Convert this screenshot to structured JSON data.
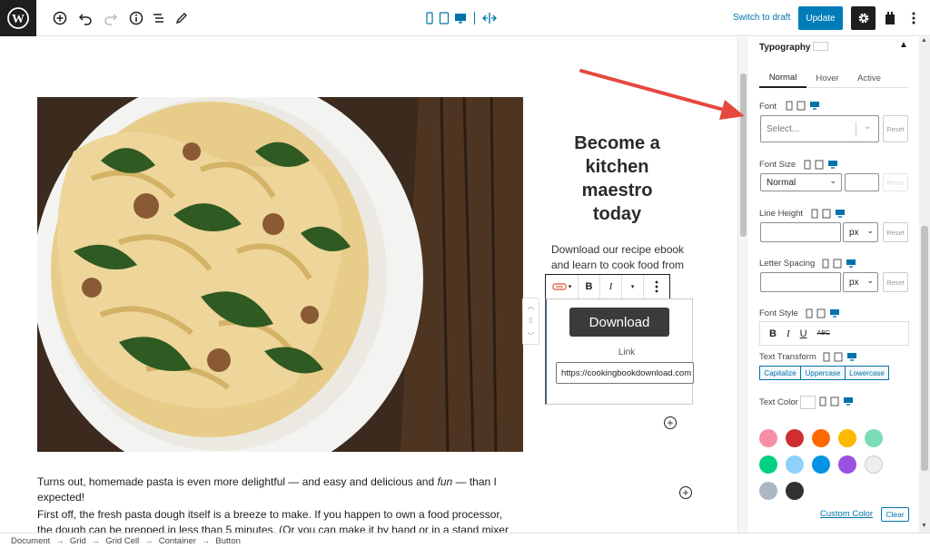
{
  "toolbar": {
    "switch_to_draft": "Switch to draft",
    "update": "Update",
    "icons": [
      "wordpress-logo",
      "add-block-icon",
      "undo-icon",
      "redo-icon",
      "info-icon",
      "list-view-icon",
      "edit-icon",
      "mobile-preview-icon",
      "tablet-preview-icon",
      "desktop-preview-icon",
      "responsive-width-icon",
      "gear-icon",
      "plugin-icon",
      "more-options-icon"
    ]
  },
  "editor": {
    "promo_title": "Become a kitchen maestro today",
    "promo_text": "Download our recipe ebook and learn to cook food from",
    "button_label": "Download",
    "link_label": "Link",
    "link_value": "https://cookingbookdownload.com",
    "paragraph1_before": "Turns out, homemade pasta is even more delightful — and easy and delicious and ",
    "paragraph1_em": "fun",
    "paragraph1_after": " — than I expected!",
    "paragraph2": "First off, the fresh pasta dough itself is a breeze to make.  If you happen to own a food processor, the dough can be prepped in less than 5 minutes.  (Or you can make it by hand or in a stand mixer in less"
  },
  "sidebar": {
    "panel_title": "Typography",
    "tabs": [
      "Normal",
      "Hover",
      "Active"
    ],
    "active_tab": "Normal",
    "font_label": "Font",
    "font_placeholder": "Select...",
    "reset": "Reset",
    "font_size_label": "Font Size",
    "font_size_value": "Normal",
    "line_height_label": "Line Height",
    "unit_px": "px",
    "letter_spacing_label": "Letter Spacing",
    "font_style_label": "Font Style",
    "text_transform_label": "Text Transform",
    "transform_options": [
      "Capitalize",
      "Uppercase",
      "Lowercase"
    ],
    "text_color_label": "Text Color",
    "custom_color": "Custom Color",
    "clear": "Clear",
    "palette": [
      "#f78da7",
      "#cf2e2e",
      "#ff6900",
      "#fcb900",
      "#7bdcb5",
      "#00d084",
      "#8ed1fc",
      "#0693e3",
      "#9b51e0",
      "#eeeeee",
      "#abb8c3",
      "#313131"
    ]
  },
  "breadcrumb": [
    "Document",
    "Grid",
    "Grid Cell",
    "Container",
    "Button"
  ],
  "colors": {
    "accent": "#007cba",
    "link": "#0073aa",
    "dark": "#1e1e1e",
    "arrow": "#e5483f"
  }
}
